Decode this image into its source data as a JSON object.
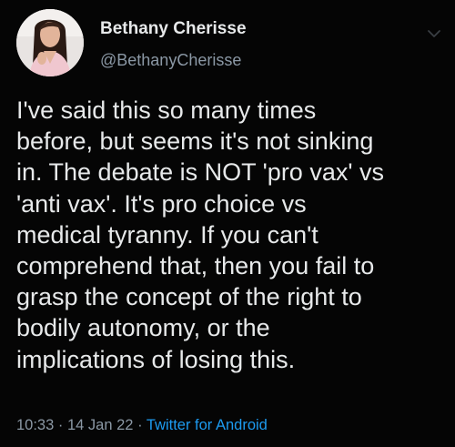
{
  "user": {
    "display_name": "Bethany Cherisse",
    "handle": "@BethanyCherisse",
    "avatar_icon": "profile-photo"
  },
  "tweet": {
    "text": "I've said this so many times\nbefore, but seems it's not sinking\nin. The debate is NOT 'pro vax' vs\n'anti vax'. It's pro choice vs\nmedical tyranny. If you can't\ncomprehend that, then you fail to\ngrasp the concept of the right to\nbodily autonomy, or the\nimplications of losing this."
  },
  "meta": {
    "time": "10:33",
    "separator": "·",
    "date": "14 Jan 22",
    "source": "Twitter for Android"
  },
  "colors": {
    "background": "#050505",
    "text": "#e7e9ea",
    "secondary": "#8b98a5",
    "link": "#1d9bf0"
  }
}
